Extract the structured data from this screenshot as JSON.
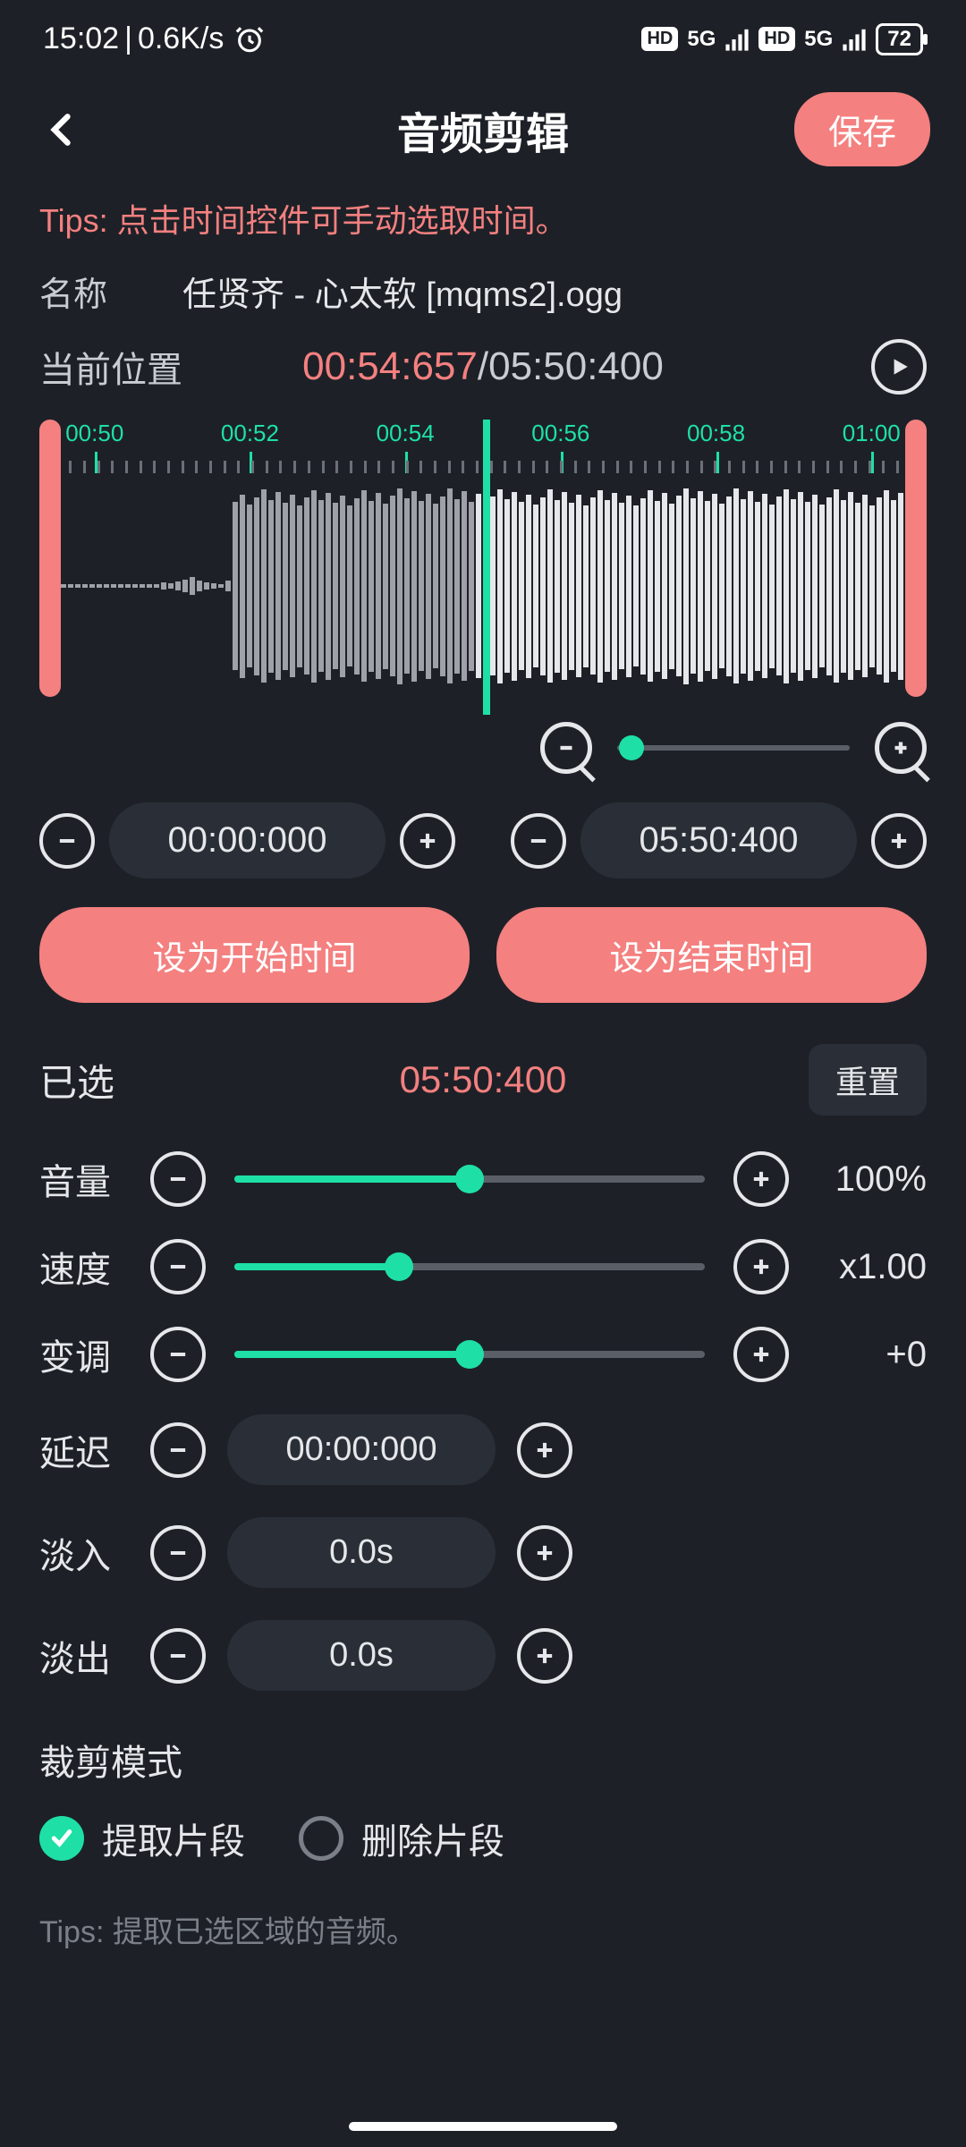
{
  "status": {
    "time": "15:02",
    "speed": "0.6K/s",
    "hd": "HD",
    "net": "5G",
    "battery": "72"
  },
  "header": {
    "title": "音频剪辑",
    "save": "保存"
  },
  "tips": "Tips: 点击时间控件可手动选取时间。",
  "name": {
    "label": "名称",
    "value": "任贤齐 - 心太软 [mqms2].ogg"
  },
  "position": {
    "label": "当前位置",
    "current": "00:54:657",
    "sep": "/",
    "total": "05:50:400"
  },
  "timeline_ticks": [
    "00:50",
    "00:52",
    "00:54",
    "00:56",
    "00:58",
    "01:00"
  ],
  "range": {
    "start": "00:00:000",
    "end": "05:50:400"
  },
  "set_buttons": {
    "start": "设为开始时间",
    "end": "设为结束时间"
  },
  "selected": {
    "label": "已选",
    "value": "05:50:400",
    "reset": "重置"
  },
  "sliders": {
    "volume": {
      "label": "音量",
      "value": "100%",
      "pct": 50
    },
    "speed": {
      "label": "速度",
      "value": "x1.00",
      "pct": 35
    },
    "pitch": {
      "label": "变调",
      "value": "+0",
      "pct": 50
    }
  },
  "delay": {
    "label": "延迟",
    "value": "00:00:000"
  },
  "fade_in": {
    "label": "淡入",
    "value": "0.0s"
  },
  "fade_out": {
    "label": "淡出",
    "value": "0.0s"
  },
  "crop_mode": {
    "title": "裁剪模式",
    "extract": "提取片段",
    "delete": "删除片段"
  },
  "footer_tip": "Tips: 提取已选区域的音频。"
}
